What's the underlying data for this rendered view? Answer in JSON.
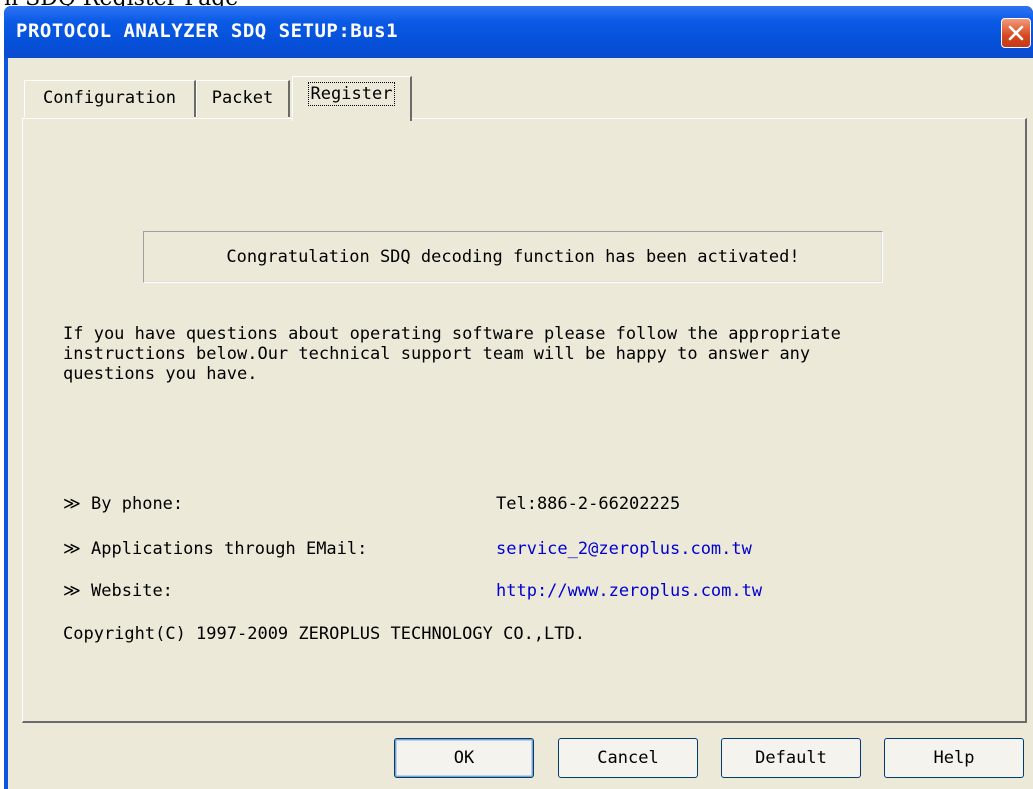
{
  "clipped_top_text": "n SDQ Register Page",
  "window": {
    "title": "PROTOCOL ANALYZER SDQ SETUP:Bus1",
    "close_icon": "close-x-icon"
  },
  "tabs": [
    {
      "label": "Configuration",
      "selected": false
    },
    {
      "label": "Packet",
      "selected": false
    },
    {
      "label": "Register",
      "selected": true
    }
  ],
  "register": {
    "activation_message": "Congratulation SDQ decoding function has been activated!",
    "support_paragraph": "If you have questions about operating software please follow the appropriate\ninstructions below.Our technical support team will be happy to answer any\nquestions you have.",
    "contacts": [
      {
        "label": "≫ By phone:",
        "value": "Tel:886-2-66202225",
        "is_link": false
      },
      {
        "label": "≫ Applications through EMail:",
        "value": "service_2@zeroplus.com.tw",
        "is_link": true
      },
      {
        "label": "≫ Website:",
        "value": "http://www.zeroplus.com.tw",
        "is_link": true
      }
    ],
    "copyright": "Copyright(C) 1997-2009 ZEROPLUS TECHNOLOGY CO.,LTD."
  },
  "buttons": {
    "ok": "OK",
    "cancel": "Cancel",
    "default": "Default",
    "help": "Help"
  },
  "colors": {
    "titlebar": "#0a56e0",
    "dialog_bg": "#ece9d8",
    "link": "#0000d0",
    "close_button": "#d8481e"
  }
}
